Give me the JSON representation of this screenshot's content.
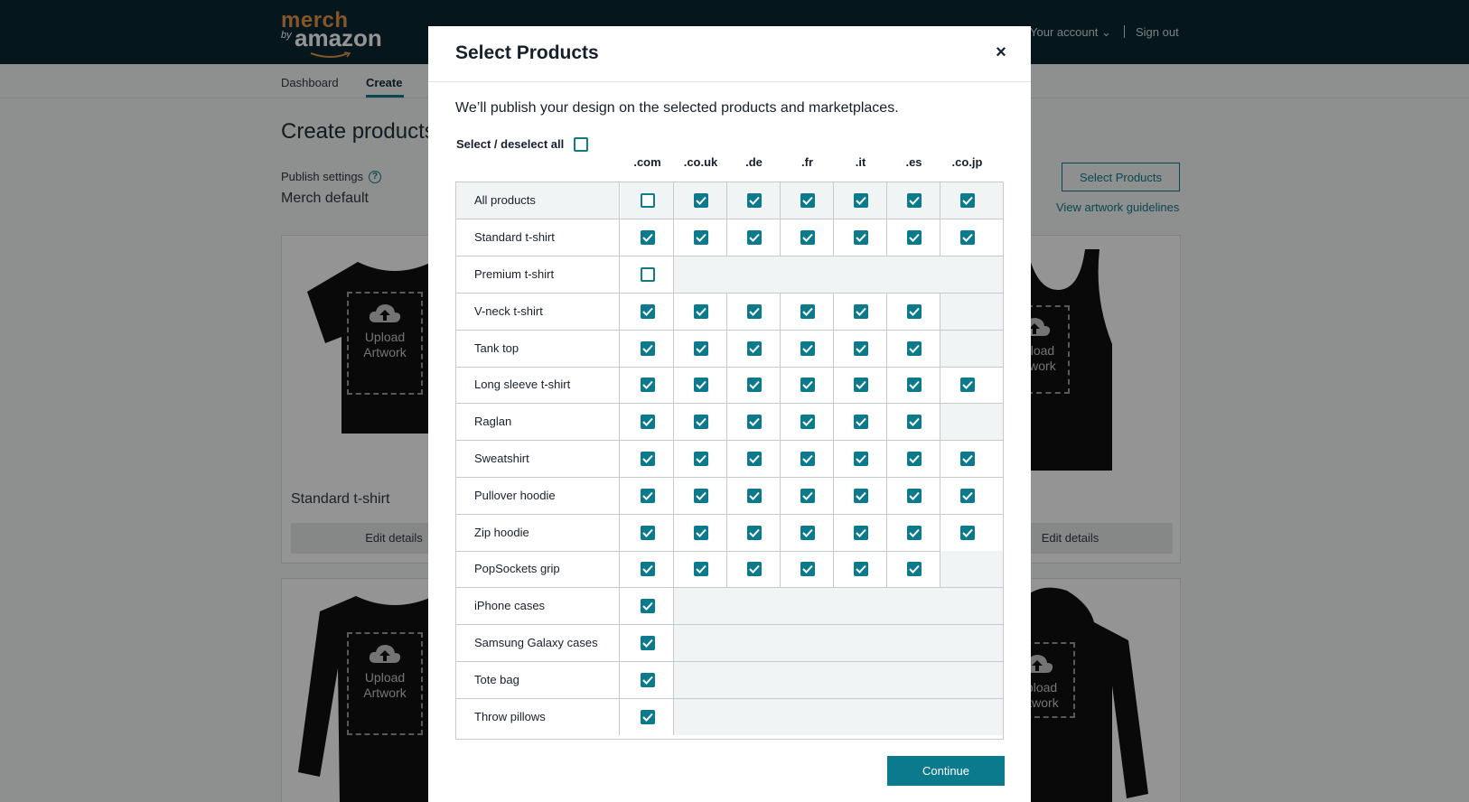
{
  "brand": {
    "name_top": "merch",
    "name_by": "by",
    "name_main": "amazon"
  },
  "account": {
    "your_account": "Your account",
    "sign_out": "Sign out"
  },
  "nav": {
    "items": [
      "Dashboard",
      "Create"
    ],
    "active": "Create"
  },
  "page": {
    "title": "Create products",
    "publish_label": "Publish settings",
    "publish_value": "Merch default",
    "select_products_button": "Select Products",
    "artwork_link": "View artwork guidelines"
  },
  "cards": {
    "upload_line1": "Upload",
    "upload_line2": "Artwork",
    "first_title": "Standard t-shirt",
    "edit_label": "Edit details"
  },
  "modal": {
    "title": "Select Products",
    "close": "×",
    "description": "We’ll publish your design on the selected products and marketplaces.",
    "select_all_label": "Select / deselect all",
    "marketplaces": [
      ".com",
      ".co.uk",
      ".de",
      ".fr",
      ".it",
      ".es",
      ".co.jp"
    ],
    "rows": [
      {
        "label": "All products",
        "cells": [
          false,
          true,
          true,
          true,
          true,
          true,
          true
        ]
      },
      {
        "label": "Standard t-shirt",
        "cells": [
          true,
          true,
          true,
          true,
          true,
          true,
          true
        ]
      },
      {
        "label": "Premium t-shirt",
        "cells": [
          false
        ]
      },
      {
        "label": "V-neck t-shirt",
        "cells": [
          true,
          true,
          true,
          true,
          true,
          true,
          null
        ]
      },
      {
        "label": "Tank top",
        "cells": [
          true,
          true,
          true,
          true,
          true,
          true,
          null
        ]
      },
      {
        "label": "Long sleeve t-shirt",
        "cells": [
          true,
          true,
          true,
          true,
          true,
          true,
          true
        ]
      },
      {
        "label": "Raglan",
        "cells": [
          true,
          true,
          true,
          true,
          true,
          true,
          null
        ]
      },
      {
        "label": "Sweatshirt",
        "cells": [
          true,
          true,
          true,
          true,
          true,
          true,
          true
        ]
      },
      {
        "label": "Pullover hoodie",
        "cells": [
          true,
          true,
          true,
          true,
          true,
          true,
          true
        ]
      },
      {
        "label": "Zip hoodie",
        "cells": [
          true,
          true,
          true,
          true,
          true,
          true,
          true
        ]
      },
      {
        "label": "PopSockets grip",
        "cells": [
          true,
          true,
          true,
          true,
          true,
          true,
          null
        ]
      },
      {
        "label": "iPhone cases",
        "cells": [
          true
        ]
      },
      {
        "label": "Samsung Galaxy cases",
        "cells": [
          true
        ]
      },
      {
        "label": "Tote bag",
        "cells": [
          true
        ]
      },
      {
        "label": "Throw pillows",
        "cells": [
          true
        ]
      }
    ],
    "continue_label": "Continue"
  },
  "colors": {
    "teal": "#0b7a8c",
    "header_bg": "#0a2733",
    "logo_orange": "#e2944b"
  }
}
